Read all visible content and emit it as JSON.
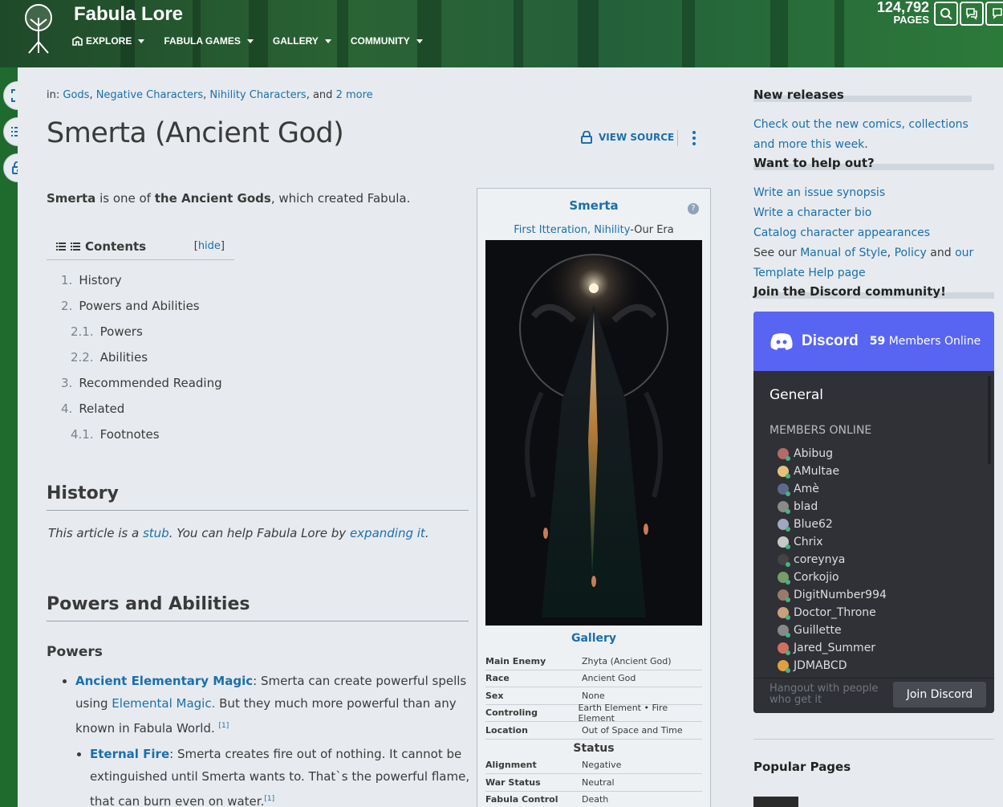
{
  "header": {
    "wiki_title": "Fabula Lore",
    "nav": [
      "EXPLORE",
      "FABULA GAMES",
      "GALLERY",
      "COMMUNITY"
    ],
    "page_count": "124,792",
    "page_count_label": "PAGES"
  },
  "article": {
    "categories_prefix": "in:",
    "categories": [
      "Gods",
      "Negative Characters",
      "Nihility Characters"
    ],
    "categories_and": ", and",
    "categories_more": "2 more",
    "title": "Smerta (Ancient God)",
    "view_source": "VIEW SOURCE",
    "intro": {
      "subject": "Smerta",
      "mid": " is one of ",
      "group": "the Ancient Gods",
      "end": ", which created Fabula."
    },
    "toc": {
      "title": "Contents",
      "hide": "hide",
      "items": [
        {
          "num": "1.",
          "label": "History",
          "level": 1
        },
        {
          "num": "2.",
          "label": "Powers and Abilities",
          "level": 1
        },
        {
          "num": "2.1.",
          "label": "Powers",
          "level": 2
        },
        {
          "num": "2.2.",
          "label": "Abilities",
          "level": 2
        },
        {
          "num": "3.",
          "label": "Recommended Reading",
          "level": 1
        },
        {
          "num": "4.",
          "label": "Related",
          "level": 1
        },
        {
          "num": "4.1.",
          "label": "Footnotes",
          "level": 2
        }
      ]
    },
    "history_heading": "History",
    "stub": {
      "pre": "This article is a ",
      "link1": "stub",
      "mid": ". You can help Fabula Lore by ",
      "link2": "expanding it",
      "end": "."
    },
    "powers_heading": "Powers and Abilities",
    "powers_sub": "Powers",
    "power1": {
      "name": "Ancient Elementary Magic",
      "text1": ": Smerta can create powerful spells using ",
      "link": "Elemental Magic.",
      "text2": " But they much more powerful than any known in Fabula World.",
      "ref": "[1]"
    },
    "power2": {
      "name": "Eternal Fire",
      "text": ": Smerta creates fire out of nothing. It cannot be extinguished until Smerta wants to. That`s the powerful flame, that can burn even on water.",
      "ref": "[1]"
    }
  },
  "infobox": {
    "name": "Smerta",
    "era_links": "First Itteration, Nihility",
    "era_text": "-Our Era",
    "gallery": "Gallery",
    "rows1": [
      {
        "k": "Main Enemy",
        "v": "Zhyta (Ancient God)",
        "link": true
      },
      {
        "k": "Race",
        "v": "Ancient God",
        "link": false
      },
      {
        "k": "Sex",
        "v": "None",
        "link": false
      },
      {
        "k": "Controling",
        "v": "Earth Element • Fire Element",
        "link": true
      },
      {
        "k": "Location",
        "v": "Out of Space and Time",
        "link": true
      }
    ],
    "status_heading": "Status",
    "rows2": [
      {
        "k": "Alignment",
        "v": "Negative",
        "link": true
      },
      {
        "k": "War Status",
        "v": "Neutral",
        "link": true
      },
      {
        "k": "Fabula Control",
        "v": "Death",
        "link": true
      }
    ]
  },
  "rail": {
    "new_releases_heading": "New releases",
    "new_releases_link": "Check out the new comics, collections and more this week",
    "help_heading": "Want to help out?",
    "help_links": [
      "Write an issue synopsis",
      "Write a character bio",
      "Catalog character appearances"
    ],
    "see_our": "See our",
    "manual": "Manual of Style",
    "policy": "Policy",
    "and": "and",
    "our_template": "our Template Help page",
    "discord_heading": "Join the Discord community!",
    "popular_heading": "Popular Pages"
  },
  "discord": {
    "brand": "Discord",
    "online_count": "59",
    "online_label": "Members Online",
    "channel": "General",
    "members_online_label": "MEMBERS ONLINE",
    "members": [
      "Abibug",
      "AMultae",
      "Amè",
      "blad",
      "Blue62",
      "Chrix",
      "coreynya",
      "Corkojio",
      "DigitNumber994",
      "Doctor_Throne",
      "Guillette",
      "Jared_Summer",
      "JDMABCD"
    ],
    "footer_text": "Hangout with people who get it",
    "join_button": "Join Discord"
  },
  "colors": {
    "link": "#1a6fae",
    "header_green": "#1f6b2e",
    "discord_blurple": "#5865f2",
    "discord_dark": "#2f3136"
  }
}
